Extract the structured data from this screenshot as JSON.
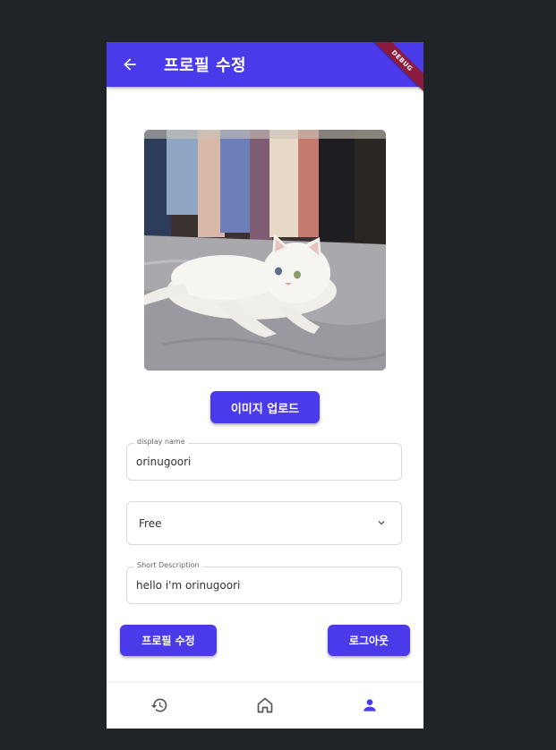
{
  "appbar": {
    "title": "프로필 수정",
    "back_icon": "arrow-left-icon",
    "debug_banner": "DEBUG",
    "color": "#4a3aea"
  },
  "profile_image": {
    "icon": "cat-photo"
  },
  "upload_button": {
    "label": "이미지 업로드"
  },
  "display_name": {
    "label": "display name",
    "value": "orinugoori"
  },
  "plan_select": {
    "selected": "Free",
    "icon": "chevron-down-icon"
  },
  "short_description": {
    "label": "Short Description",
    "value": "hello i'm orinugoori"
  },
  "actions": {
    "edit_label": "프로필 수정",
    "logout_label": "로그아웃"
  },
  "bottom_nav": {
    "items": [
      {
        "icon": "history-icon",
        "active": false
      },
      {
        "icon": "home-icon",
        "active": false
      },
      {
        "icon": "person-icon",
        "active": true
      }
    ],
    "active_color": "#4a3aea",
    "inactive_color": "#555555"
  }
}
